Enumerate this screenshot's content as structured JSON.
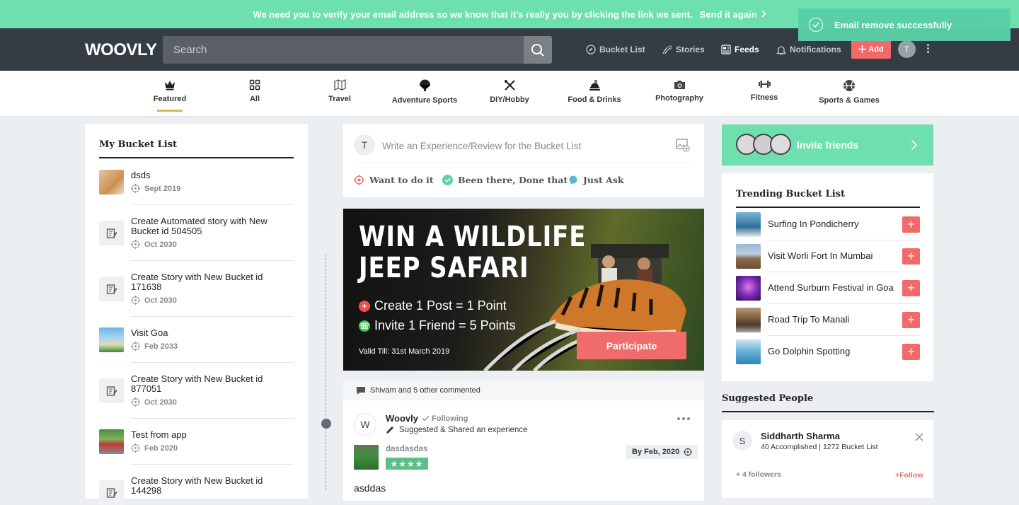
{
  "banner": {
    "message": "We need you to verify your email address so we know that it's really you by clicking the link we sent.",
    "link": "Send it again"
  },
  "toast": {
    "message": "Email remove successfully"
  },
  "header": {
    "logo": "WOOVLY",
    "search_placeholder": "Search",
    "nav": [
      {
        "label": "Bucket List",
        "icon": "compass-icon"
      },
      {
        "label": "Stories",
        "icon": "stories-icon"
      },
      {
        "label": "Feeds",
        "icon": "feeds-icon"
      },
      {
        "label": "Notifications",
        "icon": "bell-icon"
      }
    ],
    "add_label": "Add",
    "avatar_initial": "T"
  },
  "categories": [
    {
      "label": "Featured",
      "icon": "crown-icon",
      "active": true
    },
    {
      "label": "All",
      "icon": "grid-icon"
    },
    {
      "label": "Travel",
      "icon": "map-icon"
    },
    {
      "label": "Adventure Sports",
      "icon": "parachute-icon"
    },
    {
      "label": "DIY/Hobby",
      "icon": "tools-icon"
    },
    {
      "label": "Food & Drinks",
      "icon": "food-icon"
    },
    {
      "label": "Photography",
      "icon": "camera-icon"
    },
    {
      "label": "Fitness",
      "icon": "dumbbell-icon"
    },
    {
      "label": "Sports & Games",
      "icon": "ball-icon"
    }
  ],
  "my_bucket_list": {
    "title": "My Bucket List",
    "items": [
      {
        "title": "dsds",
        "date": "Sept 2019",
        "thumb": "dog"
      },
      {
        "title": "Create Automated story with New Bucket id 504505",
        "date": "Oct 2030",
        "thumb": "icon"
      },
      {
        "title": "Create Story with New Bucket id 171638",
        "date": "Oct 2030",
        "thumb": "icon"
      },
      {
        "title": "Visit Goa",
        "date": "Feb 2033",
        "thumb": "beach"
      },
      {
        "title": "Create Story with New Bucket id 877051",
        "date": "Oct 2030",
        "thumb": "icon"
      },
      {
        "title": "Test from app",
        "date": "Feb 2020",
        "thumb": "car"
      },
      {
        "title": "Create Story with New Bucket id 144298",
        "date": "",
        "thumb": "icon"
      }
    ]
  },
  "composer": {
    "avatar_initial": "T",
    "placeholder": "Write an Experience/Review for the Bucket List",
    "actions": [
      "Want to do it",
      "Been there, Done that",
      "Just Ask"
    ]
  },
  "promo": {
    "headline_1": "WIN A WILDLIFE",
    "headline_2": "JEEP SAFARI",
    "point_1": "Create 1 Post = 1 Point",
    "point_2": "Invite 1 Friend = 5 Points",
    "valid": "Valid Till: 31st March 2019",
    "button": "Participate"
  },
  "feed_post": {
    "commented": "Shivam and 5 other commented",
    "avatar_initial": "W",
    "author": "Woovly",
    "following": "Following",
    "action": "Suggested & Shared an experience",
    "bucket": "dasdasdas",
    "rating": 4,
    "by_date": "By Feb, 2020",
    "body": "asddas"
  },
  "invite": {
    "label": "Invite friends"
  },
  "trending": {
    "title": "Trending Bucket List",
    "items": [
      {
        "name": "Surfing In Pondicherry",
        "color": "#3a7fa8"
      },
      {
        "name": "Visit Worli Fort In Mumbai",
        "color": "#8a6a4a"
      },
      {
        "name": "Attend Surburn Festival in Goa",
        "color": "#6b3aa8"
      },
      {
        "name": "Road Trip To Manali",
        "color": "#7a5a3a"
      },
      {
        "name": "Go Dolphin Spotting",
        "color": "#4aa0c8"
      }
    ]
  },
  "suggested": {
    "title": "Suggested People",
    "person": {
      "initial": "S",
      "name": "Siddharth Sharma",
      "stats": "40 Accomplished | 1272 Bucket List",
      "followers": "+ 4 followers",
      "follow": "+Follow"
    }
  },
  "colors": {
    "accent_green": "#6ee0b0",
    "accent_red": "#f06a6a",
    "header_dark": "#353c43",
    "featured_underline": "#e2b54a"
  }
}
